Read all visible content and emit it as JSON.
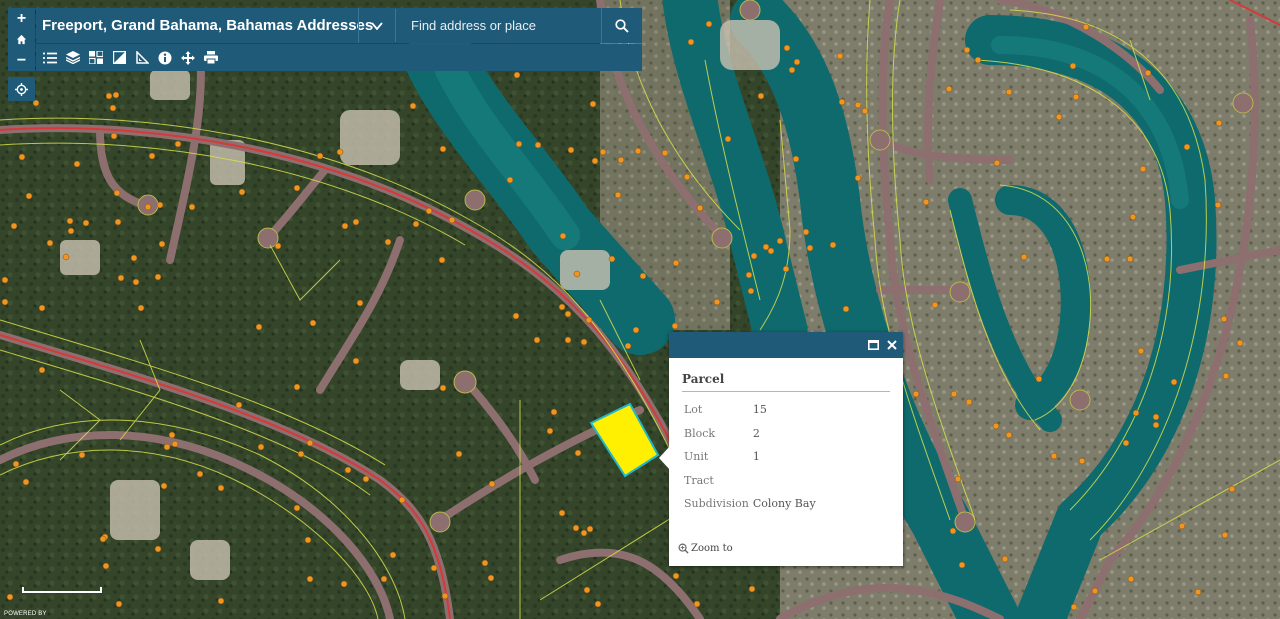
{
  "app": {
    "title": "Freeport, Grand Bahama, Bahamas Addresses",
    "search_placeholder": "Find address or place"
  },
  "zoom": {
    "in_label": "+",
    "out_label": "−",
    "home_icon": "home-icon",
    "locate_icon": "locate-icon"
  },
  "toolbar": {
    "tools": [
      "list-icon",
      "layers-icon",
      "basemap-icon",
      "print-area-icon",
      "measure-icon",
      "info-icon",
      "pan-icon",
      "print-icon"
    ]
  },
  "popup": {
    "title": "Parcel",
    "fields": [
      {
        "key": "Lot",
        "value": "15"
      },
      {
        "key": "Block",
        "value": "2"
      },
      {
        "key": "Unit",
        "value": "1"
      },
      {
        "key": "Tract",
        "value": ""
      },
      {
        "key": "Subdivision",
        "value": "Colony Bay"
      }
    ],
    "zoom_link": "Zoom to"
  },
  "footer": {
    "powered": "POWERED BY"
  },
  "colors": {
    "accent": "#1f5a78",
    "parcel_line": "#d6e04a",
    "road_red": "#d43a3a",
    "water": "#0f6a6e",
    "highlight": "#ffef00"
  }
}
